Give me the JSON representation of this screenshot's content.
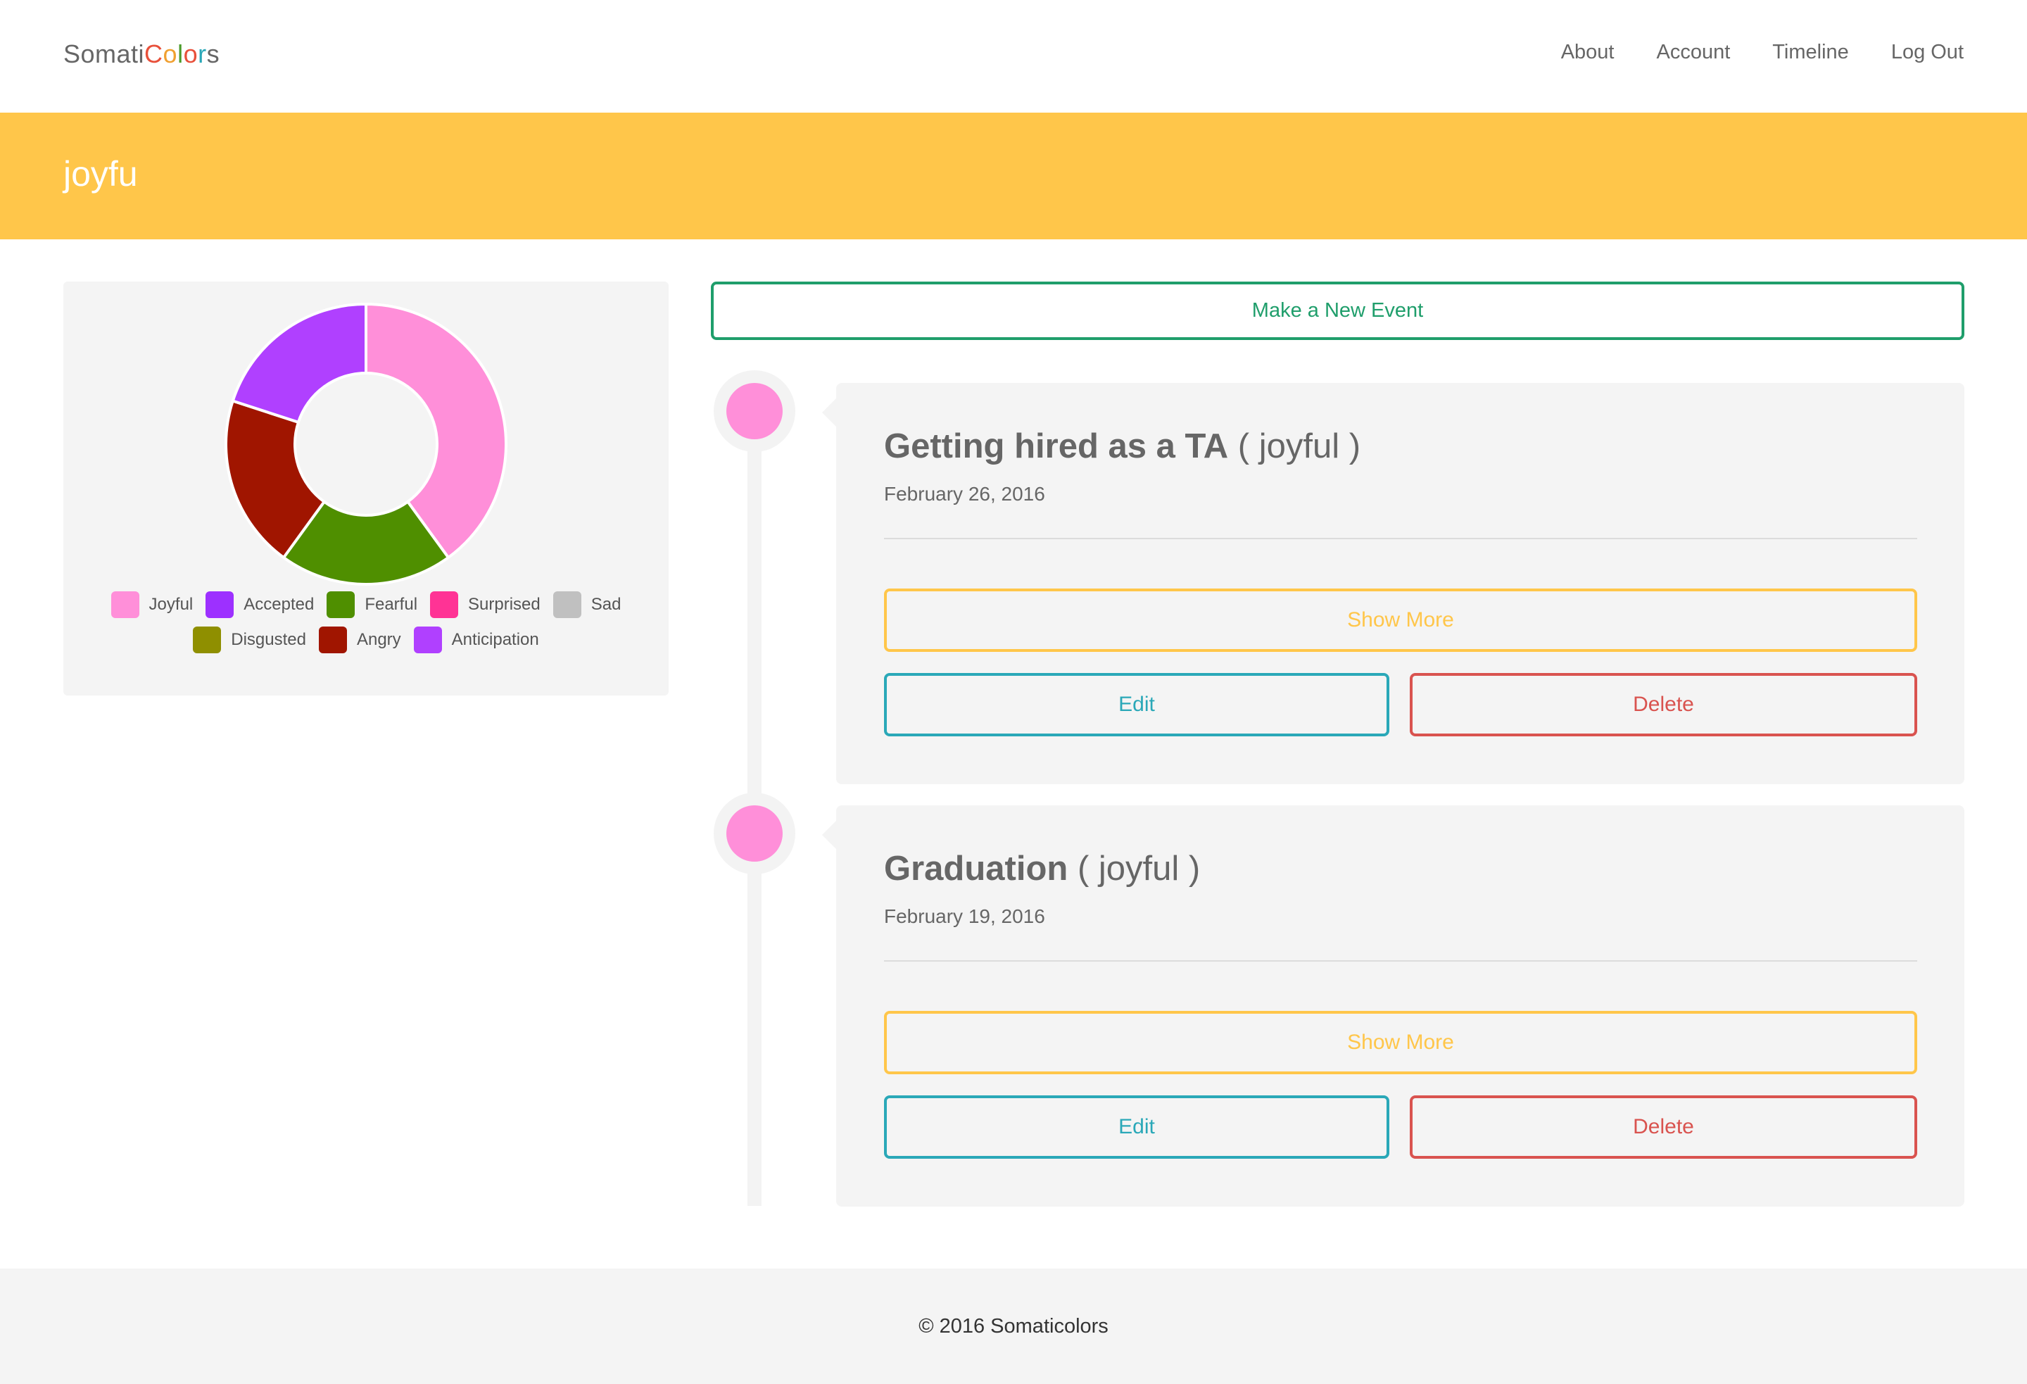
{
  "navbar": {
    "brand_parts": [
      {
        "text": "Somati",
        "color": "#666666"
      },
      {
        "text": "C",
        "color": "#e8503a"
      },
      {
        "text": "o",
        "color": "#f0a030"
      },
      {
        "text": "l",
        "color": "#4a9a2a"
      },
      {
        "text": "o",
        "color": "#e8503a"
      },
      {
        "text": "r",
        "color": "#2aa8b8"
      },
      {
        "text": "s",
        "color": "#666666"
      }
    ],
    "links": [
      "About",
      "Account",
      "Timeline",
      "Log Out"
    ]
  },
  "banner": {
    "title": "joyfu",
    "color": "#ffc64a"
  },
  "chart_data": {
    "type": "pie",
    "donut": true,
    "categories": [
      "Joyful",
      "Accepted",
      "Fearful",
      "Surprised",
      "Sad",
      "Disgusted",
      "Angry",
      "Anticipation"
    ],
    "values": [
      40,
      0,
      20,
      0,
      0,
      0,
      20,
      20
    ],
    "colors": [
      "#ff8fd9",
      "#9d30ff",
      "#4f8f00",
      "#ff3395",
      "#c0c0c0",
      "#8f8f00",
      "#a01500",
      "#b040ff"
    ],
    "legend": "bottom"
  },
  "actions": {
    "make_event": "Make a New Event"
  },
  "events": [
    {
      "title": "Getting hired as a TA",
      "emotion": "( joyful )",
      "date": "February 26, 2016",
      "show_more": "Show More",
      "edit": "Edit",
      "delete": "Delete"
    },
    {
      "title": "Graduation",
      "emotion": "( joyful )",
      "date": "February 19, 2016",
      "show_more": "Show More",
      "edit": "Edit",
      "delete": "Delete"
    }
  ],
  "footer": {
    "text": "© 2016 Somaticolors"
  }
}
